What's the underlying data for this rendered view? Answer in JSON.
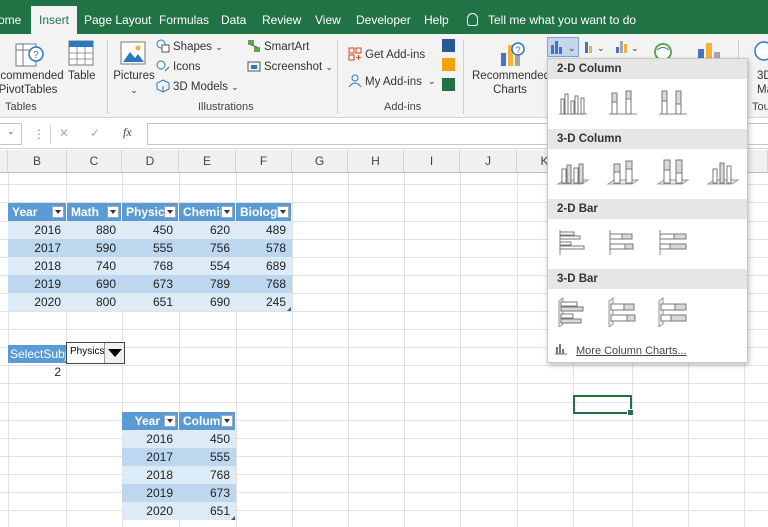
{
  "ribbon_tabs": [
    "ome",
    "Insert",
    "Page Layout",
    "Formulas",
    "Data",
    "Review",
    "View",
    "Developer",
    "Help"
  ],
  "tell_me": "Tell me what you want to do",
  "ribbon": {
    "tables": {
      "recommended_pivot_line1": "ecommended",
      "recommended_pivot_line2": "PivotTables",
      "table": "Table",
      "group": "Tables"
    },
    "illustrations": {
      "pictures": "Pictures",
      "shapes": "Shapes",
      "icons": "Icons",
      "models": "3D Models",
      "smartart": "SmartArt",
      "screenshot": "Screenshot",
      "group": "Illustrations"
    },
    "addins": {
      "get": "Get Add-ins",
      "my": "My Add-ins",
      "group": "Add-ins"
    },
    "charts": {
      "recommended_line1": "Recommended",
      "recommended_line2": "Charts"
    },
    "maps": {
      "line1": "3D",
      "line2": "Map"
    },
    "tours_group": "Tou"
  },
  "formula_bar": {
    "fx": "fx",
    "cancel": "✕",
    "confirm": "✓"
  },
  "columns": [
    "B",
    "C",
    "D",
    "E",
    "F",
    "G",
    "H",
    "I",
    "J",
    "K"
  ],
  "table1": {
    "headers": [
      "Year",
      "Math",
      "Physic",
      "Chemis",
      "Biolog"
    ],
    "rows": [
      [
        "2016",
        "880",
        "450",
        "620",
        "489"
      ],
      [
        "2017",
        "590",
        "555",
        "756",
        "578"
      ],
      [
        "2018",
        "740",
        "768",
        "554",
        "689"
      ],
      [
        "2019",
        "690",
        "673",
        "789",
        "768"
      ],
      [
        "2020",
        "800",
        "651",
        "690",
        "245"
      ]
    ]
  },
  "select_label": "SelectSubj.",
  "select_index": "2",
  "combo_value": "Physics",
  "table2": {
    "headers": [
      "Year",
      "Colum"
    ],
    "rows": [
      [
        "2016",
        "450"
      ],
      [
        "2017",
        "555"
      ],
      [
        "2018",
        "768"
      ],
      [
        "2019",
        "673"
      ],
      [
        "2020",
        "651"
      ]
    ]
  },
  "chart_menu": {
    "sections": [
      "2-D Column",
      "3-D Column",
      "2-D Bar",
      "3-D Bar"
    ],
    "more": "More Column Charts..."
  },
  "colors": {
    "excel_green": "#217346",
    "table_header": "#5b9bd5",
    "band_light": "#ddebf7",
    "band_dark": "#bdd7ee"
  }
}
